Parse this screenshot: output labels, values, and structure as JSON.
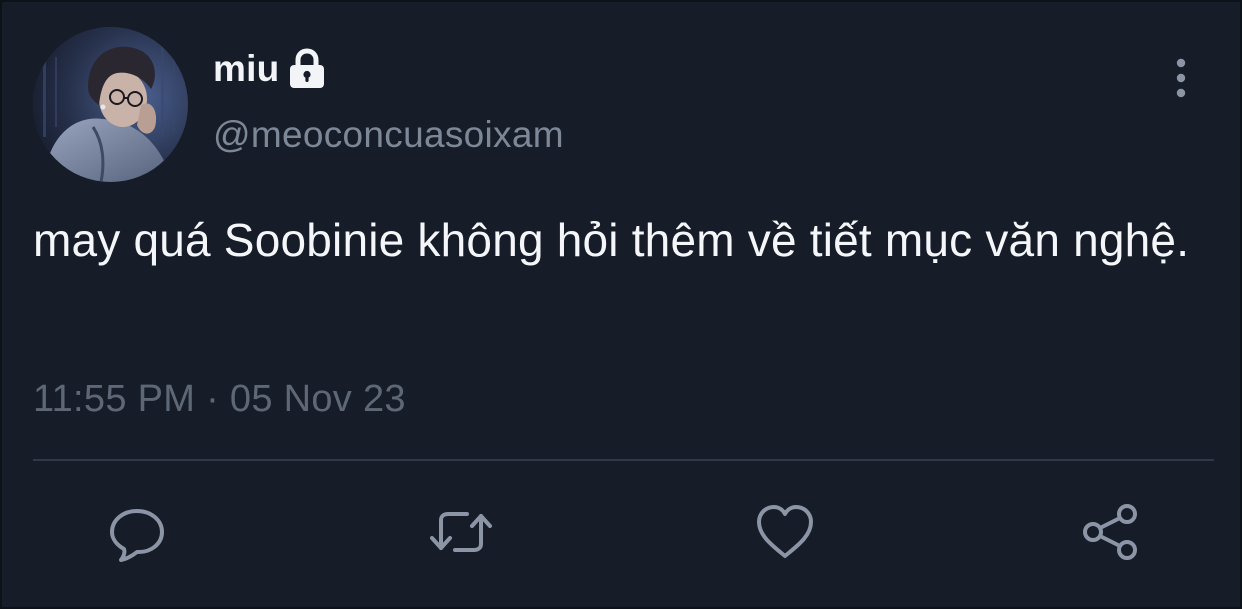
{
  "tweet": {
    "display_name": "miu",
    "handle": "@meoconcuasoixam",
    "text": "may quá Soobinie không hỏi thêm về tiết mục văn nghệ.",
    "timestamp": "11:55 PM · 05 Nov 23",
    "protected": true
  },
  "icons": {
    "lock": "lock-icon",
    "more": "more-vertical-icon",
    "reply": "reply-icon",
    "retweet": "retweet-icon",
    "like": "heart-icon",
    "share": "share-icon"
  },
  "colors": {
    "background": "#161d28",
    "text_primary": "#f4f6f9",
    "text_secondary": "#7c8797",
    "text_muted": "#5d6776",
    "divider": "#303947",
    "icon": "#8b95a5"
  }
}
